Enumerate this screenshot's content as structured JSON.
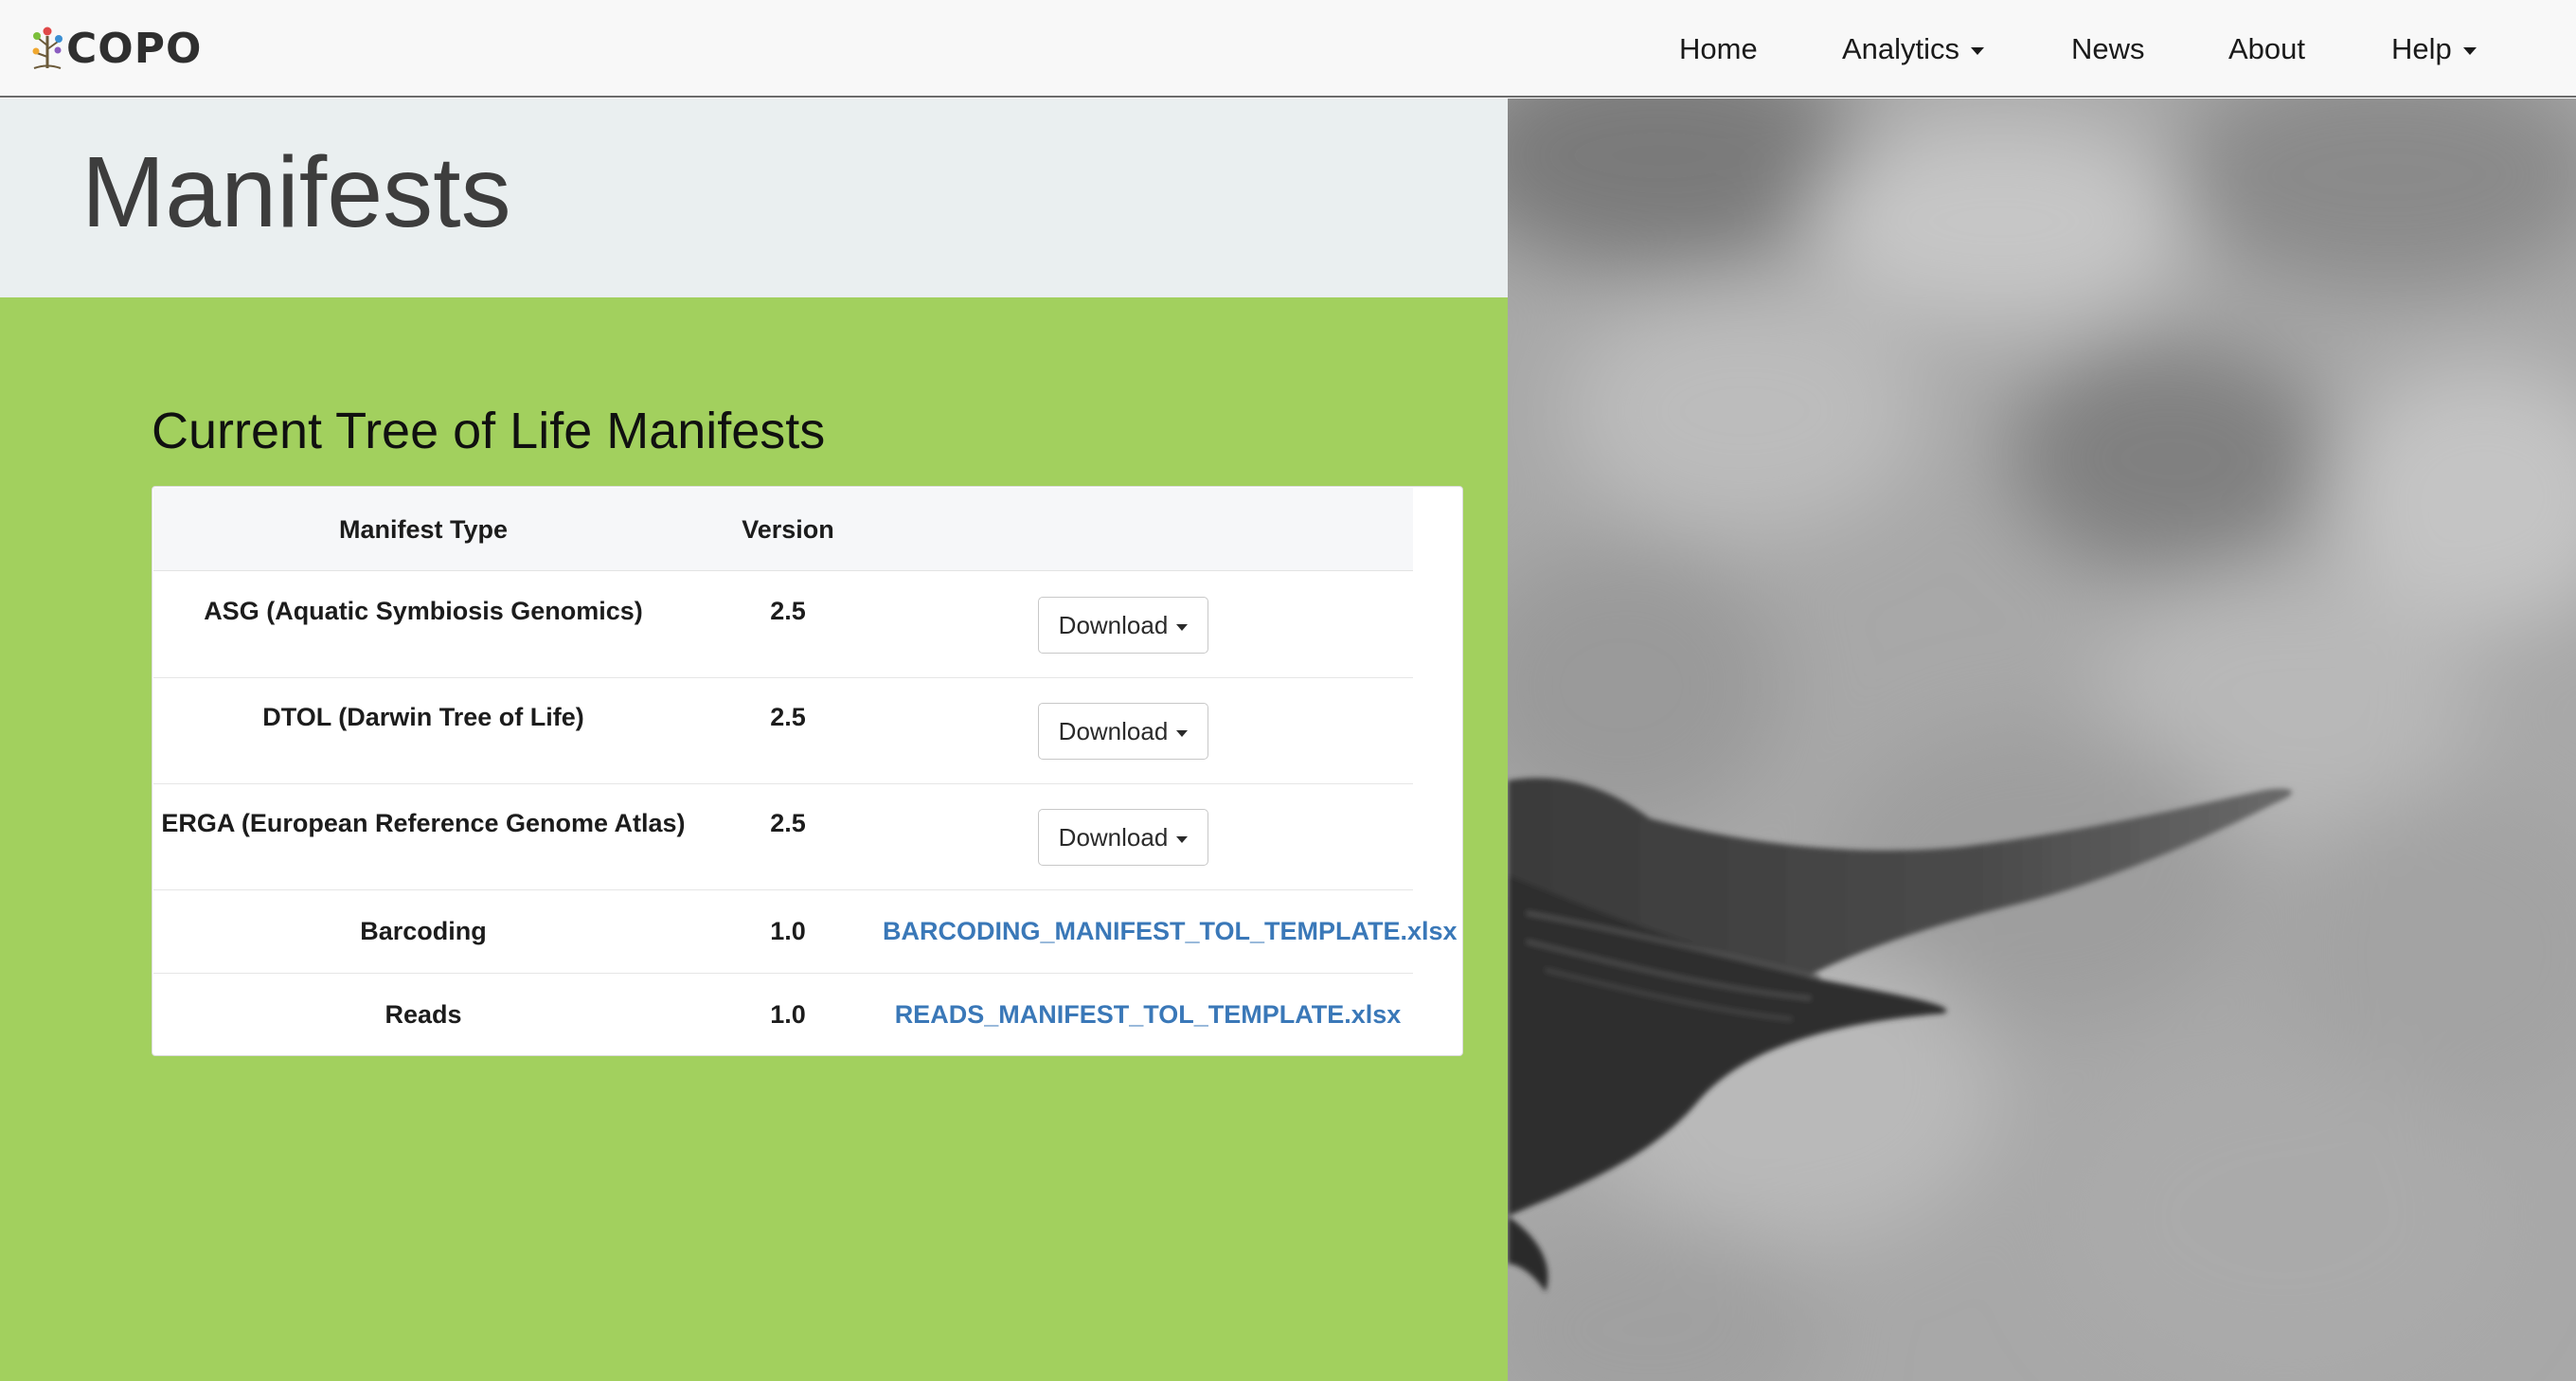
{
  "app": {
    "brand": "COPO"
  },
  "nav": {
    "home": "Home",
    "analytics": "Analytics",
    "news": "News",
    "about": "About",
    "help": "Help"
  },
  "page": {
    "title": "Manifests",
    "section_title": "Current Tree of Life Manifests"
  },
  "table": {
    "headers": {
      "type": "Manifest Type",
      "version": "Version"
    },
    "rows": [
      {
        "type": "ASG (Aquatic Symbiosis Genomics)",
        "version": "2.5",
        "action": "Download"
      },
      {
        "type": "DTOL (Darwin Tree of Life)",
        "version": "2.5",
        "action": "Download"
      },
      {
        "type": "ERGA (European Reference Genome Atlas)",
        "version": "2.5",
        "action": "Download"
      },
      {
        "type": "Barcoding",
        "version": "1.0",
        "link": "BARCODING_MANIFEST_TOL_TEMPLATE.xlsx"
      },
      {
        "type": "Reads",
        "version": "1.0",
        "link": "READS_MANIFEST_TOL_TEMPLATE.xlsx"
      }
    ]
  },
  "colors": {
    "green_panel": "#a2d05e",
    "hero_bg": "#eaeff0",
    "link": "#3a78b8",
    "navbar_bg": "#f8f8f8"
  },
  "icons": {
    "logo": "copo-tree-logo-icon",
    "dropdown": "caret-down-icon"
  }
}
